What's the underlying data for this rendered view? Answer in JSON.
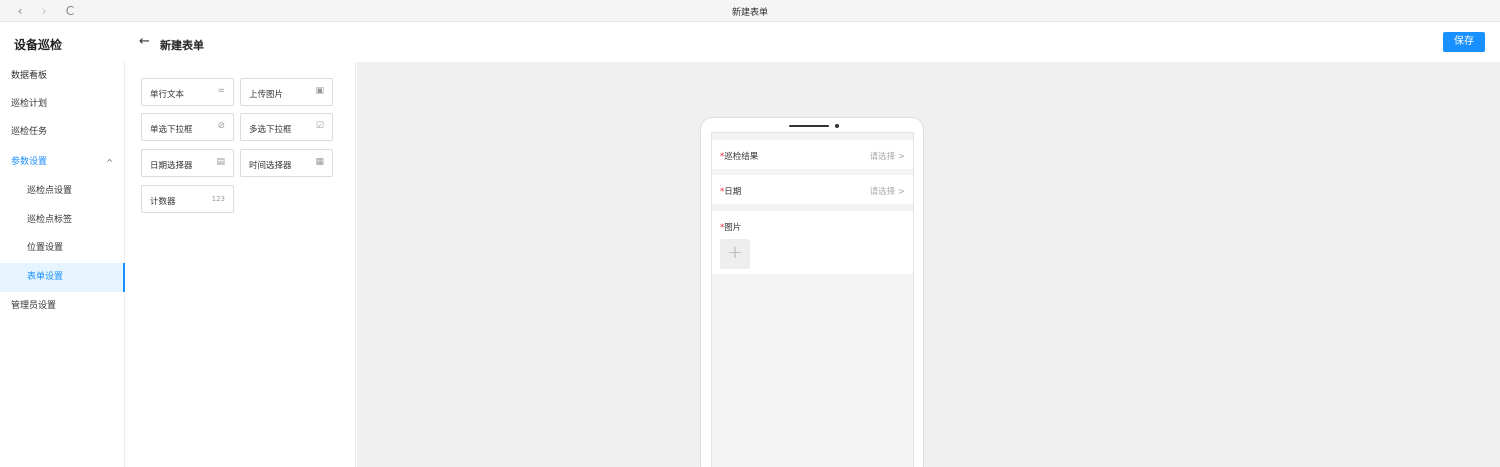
{
  "browser": {
    "back_icon": "‹",
    "forward_icon": "›",
    "reload_icon": "C",
    "window_title": "新建表单"
  },
  "header": {
    "app_title": "设备巡检",
    "back_icon": "←",
    "page_title": "新建表单",
    "save_label": "保存",
    "accent_color": "#1890ff"
  },
  "sidebar": {
    "items": [
      {
        "label": "数据看板"
      },
      {
        "label": "巡检计划"
      },
      {
        "label": "巡检任务"
      },
      {
        "label": "参数设置",
        "caret": "^"
      },
      {
        "label": "巡检点设置"
      },
      {
        "label": "巡检点标签"
      },
      {
        "label": "位置设置"
      },
      {
        "label": "表单设置"
      },
      {
        "label": "管理员设置"
      }
    ]
  },
  "components": [
    {
      "label": "单行文本",
      "icon": "="
    },
    {
      "label": "上传图片",
      "icon": "▣"
    },
    {
      "label": "单选下拉框",
      "icon": "⊘"
    },
    {
      "label": "多选下拉框",
      "icon": "☑"
    },
    {
      "label": "日期选择器",
      "icon": "▤"
    },
    {
      "label": "时间选择器",
      "icon": "▦"
    },
    {
      "label": "计数器",
      "icon": "123"
    }
  ],
  "preview": {
    "required_mark": "*",
    "fields": [
      {
        "label": "巡检结果",
        "value": "请选择 >"
      },
      {
        "label": "日期",
        "value": "请选择 >"
      },
      {
        "label": "图片",
        "value": ""
      }
    ],
    "upload_icon": "+"
  }
}
